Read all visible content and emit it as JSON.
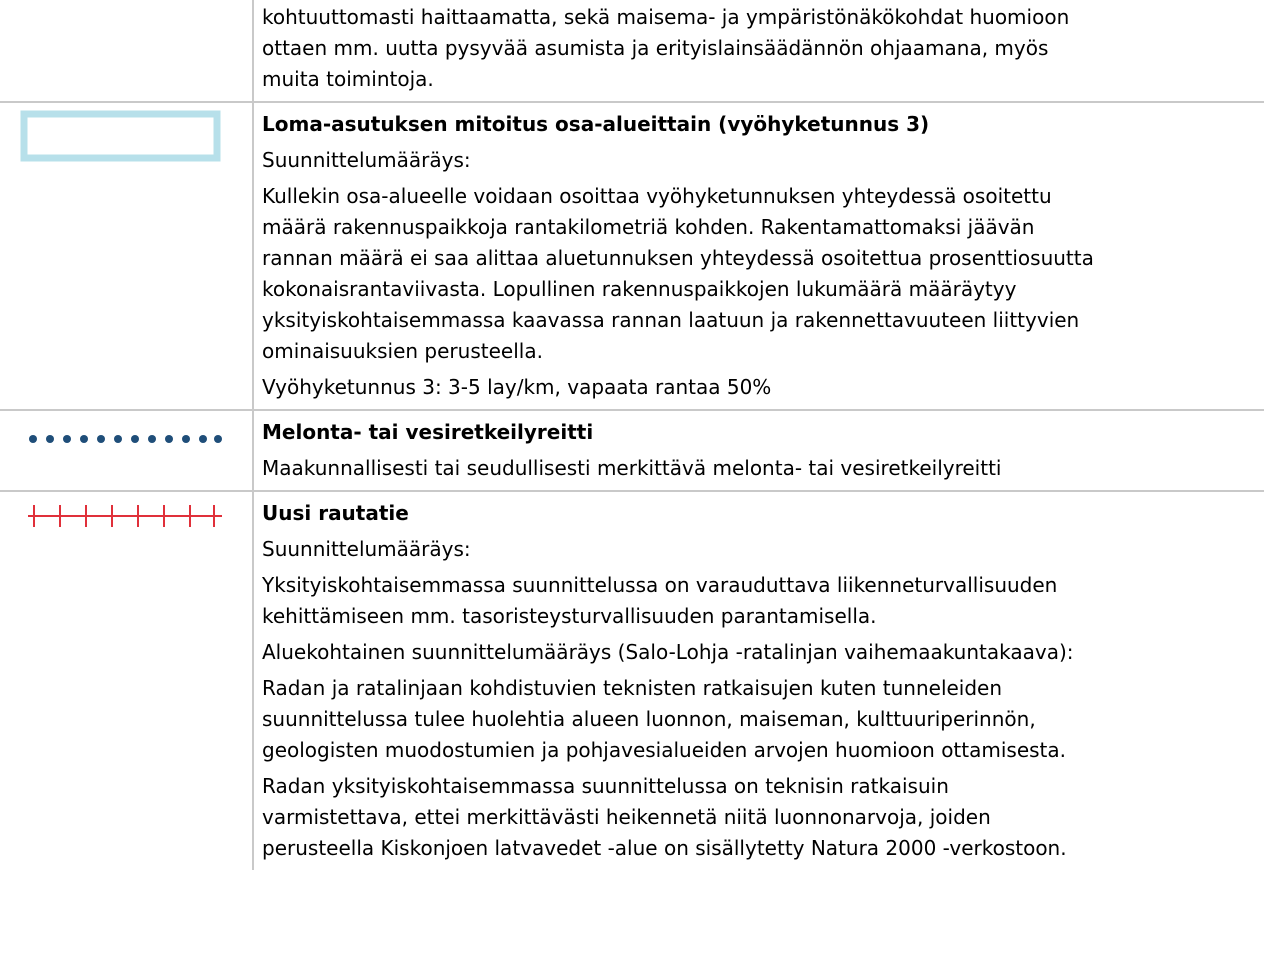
{
  "rows": [
    {
      "symbol": "none",
      "lines": [
        "kohtuuttomasti haittaamatta, sekä maisema- ja ympäristönäkökohdat huomioon",
        "ottaen mm. uutta pysyvää asumista ja erityislainsäädännön ohjaamana, myös",
        "muita toimintoja."
      ]
    },
    {
      "symbol": "light-blue-rectangle-outline",
      "symbol_color": "#b7e0ea",
      "title": "Loma-asutuksen mitoitus osa-alueittain (vyöhyketunnus 3)",
      "label": "Suunnittelumääräys:",
      "lines": [
        "Kullekin osa-alueelle voidaan osoittaa vyöhyketunnuksen yhteydessä osoitettu",
        "määrä rakennuspaikkoja rantakilometriä kohden. Rakentamattomaksi jäävän",
        "rannan määrä ei saa alittaa aluetunnuksen yhteydessä osoitettua prosenttiosuutta",
        "kokonaisrantaviivasta. Lopullinen rakennuspaikkojen lukumäärä määräytyy",
        "yksityiskohtaisemmassa kaavassa rannan laatuun ja rakennettavuuteen liittyvien",
        "ominaisuuksien perusteella."
      ],
      "note": "Vyöhyketunnus 3: 3-5 lay/km, vapaata rantaa 50%"
    },
    {
      "symbol": "dark-blue-dotted-line",
      "symbol_color": "#1f4e79",
      "title": "Melonta- tai vesiretkeilyreitti",
      "lines": [
        "Maakunnallisesti tai seudullisesti merkittävä melonta- tai vesiretkeilyreitti"
      ]
    },
    {
      "symbol": "red-railway-line",
      "symbol_color": "#e0303a",
      "title": "Uusi rautatie",
      "label": "Suunnittelumääräys:",
      "para1": [
        "Yksityiskohtaisemmassa suunnittelussa on varauduttava liikenneturvallisuuden",
        "kehittämiseen mm. tasoristeysturvallisuuden parantamisella."
      ],
      "label2": "Aluekohtainen suunnittelumääräys (Salo-Lohja -ratalinjan vaihemaakuntakaava):",
      "para2": [
        "Radan ja ratalinjaan kohdistuvien teknisten ratkaisujen kuten tunneleiden",
        "suunnittelussa tulee huolehtia alueen luonnon, maiseman, kulttuuriperinnön,",
        "geologisten muodostumien ja pohjavesialueiden arvojen huomioon ottamisesta."
      ],
      "para3": [
        "Radan yksityiskohtaisemmassa suunnittelussa on teknisin ratkaisuin",
        "varmistettava, ettei merkittävästi heikennetä niitä luonnonarvoja, joiden",
        "perusteella Kiskonjoen latvavedet -alue on sisällytetty Natura 2000 -verkostoon."
      ]
    }
  ]
}
